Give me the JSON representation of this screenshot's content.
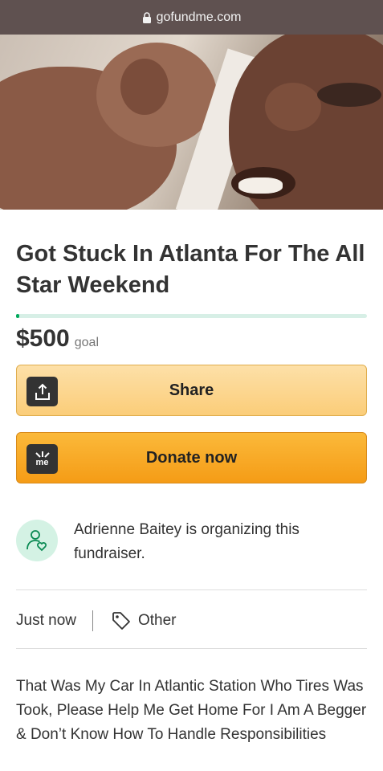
{
  "browser": {
    "url": "gofundme.com"
  },
  "campaign": {
    "title": "Got Stuck In Atlanta For The All Star Weekend",
    "progress_fraction": 0.01,
    "goal_amount": "$500",
    "goal_label": "goal",
    "share_label": "Share",
    "donate_label": "Donate now",
    "donate_icon_text": "me"
  },
  "organizer": {
    "text": "Adrienne Baitey is organizing this fundraiser."
  },
  "meta": {
    "time": "Just now",
    "category": "Other"
  },
  "story": {
    "text": "That Was My Car In Atlantic Station Who Tires Was Took, Please Help Me Get Home For I Am A Begger & Don’t Know How To Handle Responsibilities"
  },
  "colors": {
    "brand_green": "#02a95c",
    "button_orange": "#f59c16",
    "button_light": "#fbcd79"
  }
}
